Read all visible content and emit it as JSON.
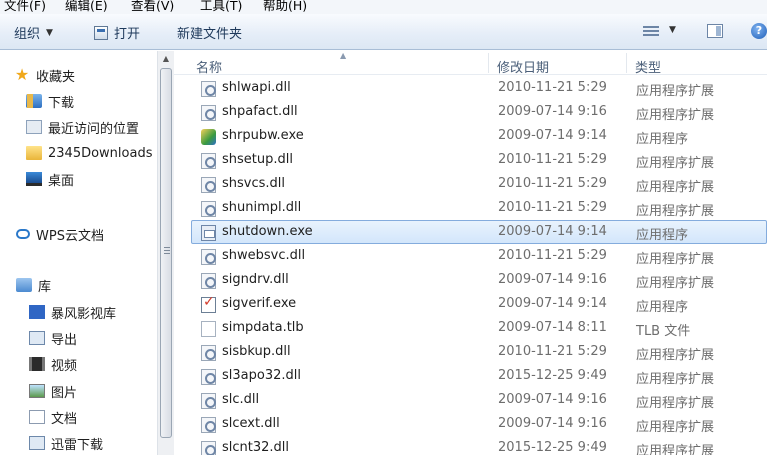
{
  "menu": [
    "文件(F)",
    "编辑(E)",
    "查看(V)",
    "工具(T)",
    "帮助(H)"
  ],
  "toolbar": {
    "organize": "组织",
    "open": "打开",
    "new_folder": "新建文件夹",
    "help": "?"
  },
  "nav": {
    "favorites": "收藏夹",
    "downloads": "下载",
    "recent": "最近访问的位置",
    "folder_2345": "2345Downloads",
    "desktop": "桌面",
    "wps": "WPS云文档",
    "library": "库",
    "storm": "暴风影视库",
    "export": "导出",
    "video": "视频",
    "pictures": "图片",
    "documents": "文档",
    "thunder": "迅雷下载"
  },
  "columns": {
    "name": "名称",
    "date": "修改日期",
    "type": "类型"
  },
  "files": [
    {
      "name": "shlwapi.dll",
      "date": "2010-11-21 5:29",
      "type": "应用程序扩展",
      "icon": "dll-icon"
    },
    {
      "name": "shpafact.dll",
      "date": "2009-07-14 9:16",
      "type": "应用程序扩展",
      "icon": "dll-icon"
    },
    {
      "name": "shrpubw.exe",
      "date": "2009-07-14 9:14",
      "type": "应用程序",
      "icon": "wizard-exe-icon"
    },
    {
      "name": "shsetup.dll",
      "date": "2010-11-21 5:29",
      "type": "应用程序扩展",
      "icon": "dll-icon"
    },
    {
      "name": "shsvcs.dll",
      "date": "2010-11-21 5:29",
      "type": "应用程序扩展",
      "icon": "dll-icon"
    },
    {
      "name": "shunimpl.dll",
      "date": "2010-11-21 5:29",
      "type": "应用程序扩展",
      "icon": "dll-icon"
    },
    {
      "name": "shutdown.exe",
      "date": "2009-07-14 9:14",
      "type": "应用程序",
      "icon": "exe-icon"
    },
    {
      "name": "shwebsvc.dll",
      "date": "2010-11-21 5:29",
      "type": "应用程序扩展",
      "icon": "dll-icon"
    },
    {
      "name": "signdrv.dll",
      "date": "2009-07-14 9:16",
      "type": "应用程序扩展",
      "icon": "dll-icon"
    },
    {
      "name": "sigverif.exe",
      "date": "2009-07-14 9:14",
      "type": "应用程序",
      "icon": "verify-exe-icon"
    },
    {
      "name": "simpdata.tlb",
      "date": "2009-07-14 8:11",
      "type": "TLB 文件",
      "icon": "blank-file-icon"
    },
    {
      "name": "sisbkup.dll",
      "date": "2010-11-21 5:29",
      "type": "应用程序扩展",
      "icon": "dll-icon"
    },
    {
      "name": "sl3apo32.dll",
      "date": "2015-12-25 9:49",
      "type": "应用程序扩展",
      "icon": "dll-icon"
    },
    {
      "name": "slc.dll",
      "date": "2009-07-14 9:16",
      "type": "应用程序扩展",
      "icon": "dll-icon"
    },
    {
      "name": "slcext.dll",
      "date": "2009-07-14 9:16",
      "type": "应用程序扩展",
      "icon": "dll-icon"
    },
    {
      "name": "slcnt32.dll",
      "date": "2015-12-25 9:49",
      "type": "应用程序扩展",
      "icon": "dll-icon"
    }
  ],
  "selected_file": "shutdown.exe"
}
